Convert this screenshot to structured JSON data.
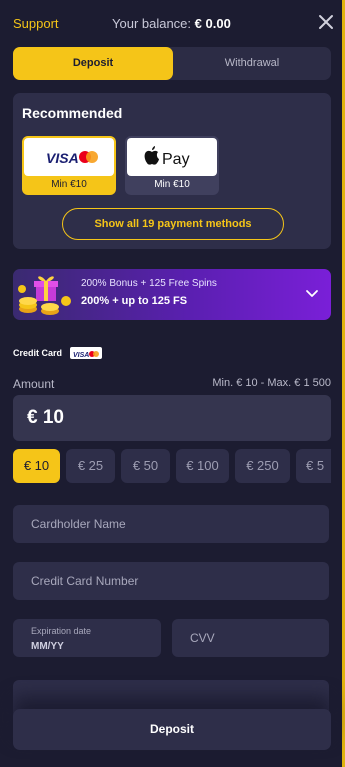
{
  "header": {
    "support_label": "Support",
    "balance_label": "Your balance:",
    "balance_value": "€ 0.00",
    "close_icon": "close-icon"
  },
  "tabs": [
    {
      "label": "Deposit",
      "active": true
    },
    {
      "label": "Withdrawal",
      "active": false
    }
  ],
  "recommended": {
    "title": "Recommended",
    "methods": [
      {
        "icon": "visa-mastercard-logo",
        "min_label": "Min €10",
        "selected": true
      },
      {
        "icon": "apple-pay-logo",
        "logo_text": "Pay",
        "min_label": "Min €10",
        "selected": false
      }
    ],
    "show_all_label": "Show all 19 payment methods"
  },
  "bonus": {
    "icon": "gift-coins-icon",
    "line1": "200% Bonus + 125 Free Spins",
    "line2": "200% + up to 125 FS",
    "chevron_icon": "chevron-down-icon"
  },
  "credit_card": {
    "label": "Credit Card",
    "badge_icon": "visa-mastercard-badge"
  },
  "amount": {
    "label": "Amount",
    "range": "Min. € 10 - Max. € 1 500",
    "value": "€ 10",
    "presets": [
      "€ 10",
      "€ 25",
      "€ 50",
      "€ 100",
      "€ 250",
      "€ 5"
    ],
    "selected_index": 0
  },
  "form": {
    "cardholder_placeholder": "Cardholder Name",
    "card_number_placeholder": "Credit Card Number",
    "expiration_label": "Expiration date",
    "expiration_placeholder": "MM/YY",
    "cvv_placeholder": "CVV"
  },
  "footer": {
    "deposit_label": "Deposit"
  },
  "colors": {
    "background": "#1c1c31",
    "panel": "#2e2e49",
    "accent": "#f5c518",
    "bonus_gradient_end": "#7a1fd8"
  }
}
